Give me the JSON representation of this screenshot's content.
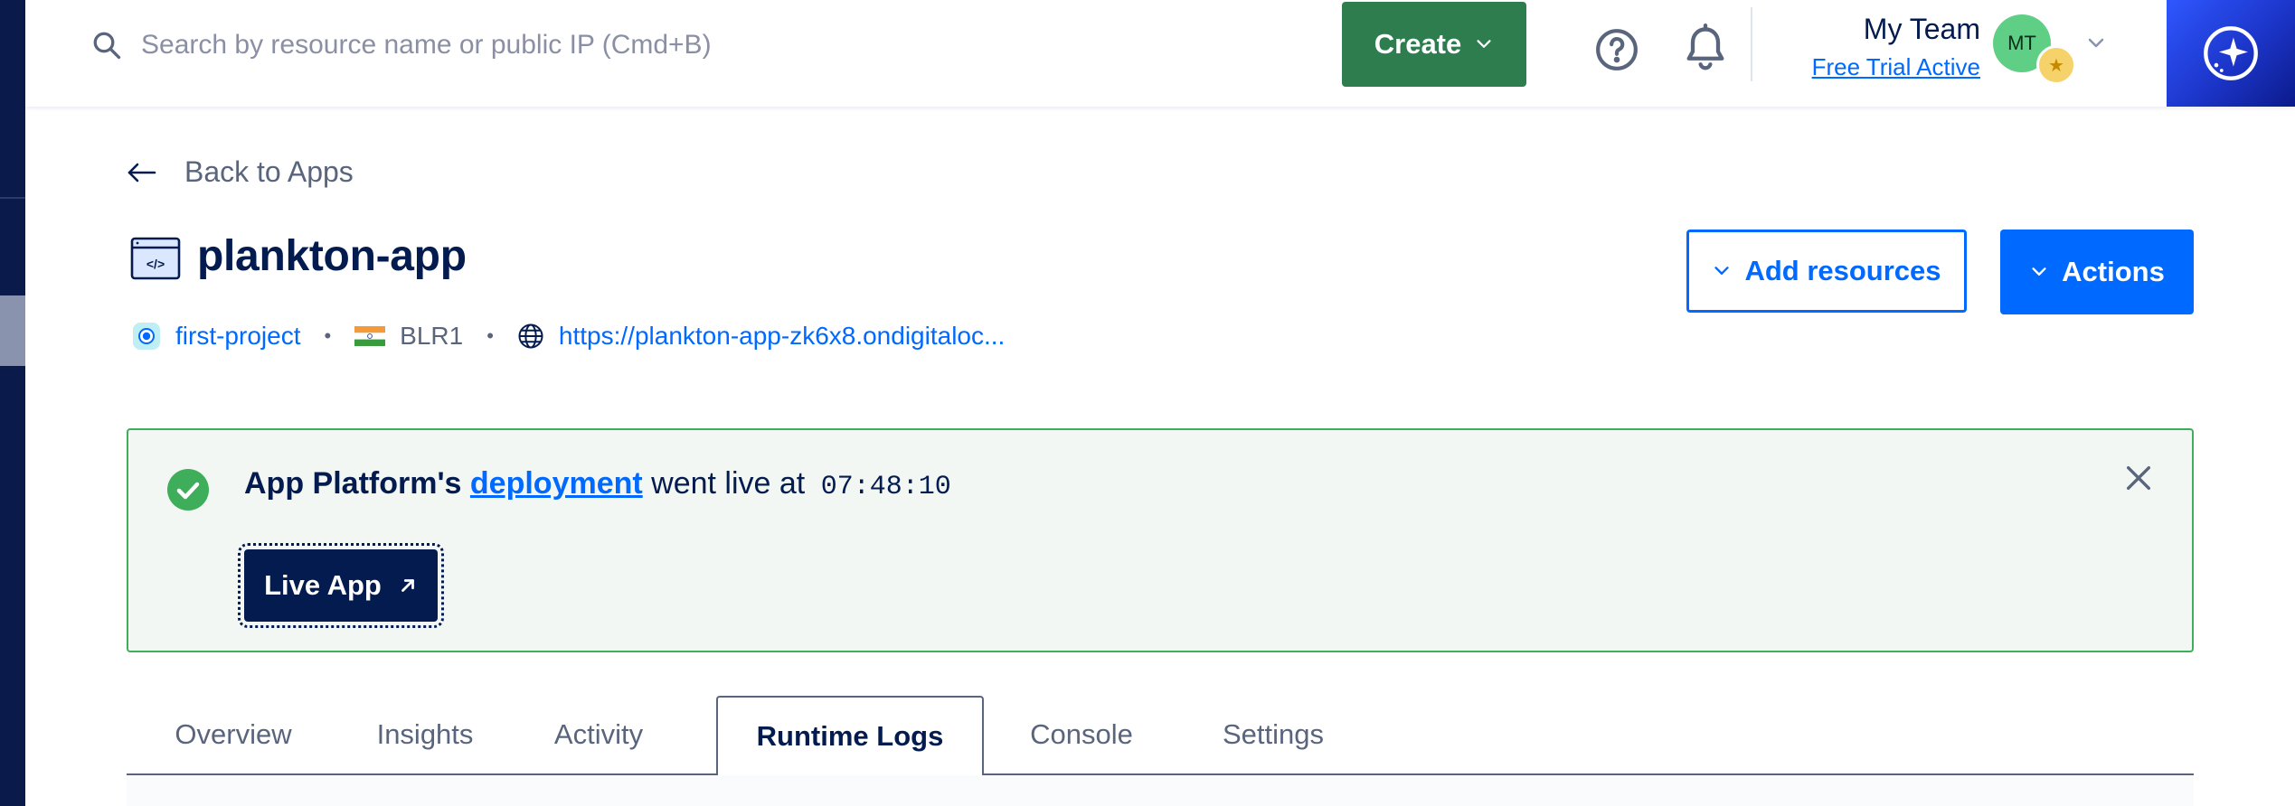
{
  "search": {
    "placeholder": "Search by resource name or public IP (Cmd+B)"
  },
  "header": {
    "create_label": "Create",
    "team_name": "My Team",
    "trial_label": "Free Trial Active",
    "avatar_initials": "MT"
  },
  "back_link": {
    "label": "Back to Apps"
  },
  "app": {
    "name": "plankton-app",
    "project": "first-project",
    "region": "BLR1",
    "url": "https://plankton-app-zk6x8.ondigitaloc..."
  },
  "buttons": {
    "add_resources": "Add resources",
    "actions": "Actions"
  },
  "banner": {
    "prefix": "App Platform's",
    "link": "deployment",
    "suffix": "went live at",
    "time": "07:48:10",
    "live_app_label": "Live App"
  },
  "tabs": [
    {
      "label": "Overview"
    },
    {
      "label": "Insights"
    },
    {
      "label": "Activity"
    },
    {
      "label": "Runtime Logs",
      "active": true
    },
    {
      "label": "Console"
    },
    {
      "label": "Settings"
    }
  ],
  "colors": {
    "brand_blue": "#0069ff",
    "create_green": "#2e7d4f",
    "success_green": "#3fae5b",
    "navy": "#031b4e"
  },
  "icons": [
    "search-icon",
    "chevron-down-icon",
    "help-icon",
    "bell-icon",
    "ai-assistant-icon",
    "back-arrow-icon",
    "app-code-icon",
    "project-icon",
    "india-flag-icon",
    "globe-icon",
    "check-circle-icon",
    "close-icon",
    "external-arrow-icon"
  ]
}
